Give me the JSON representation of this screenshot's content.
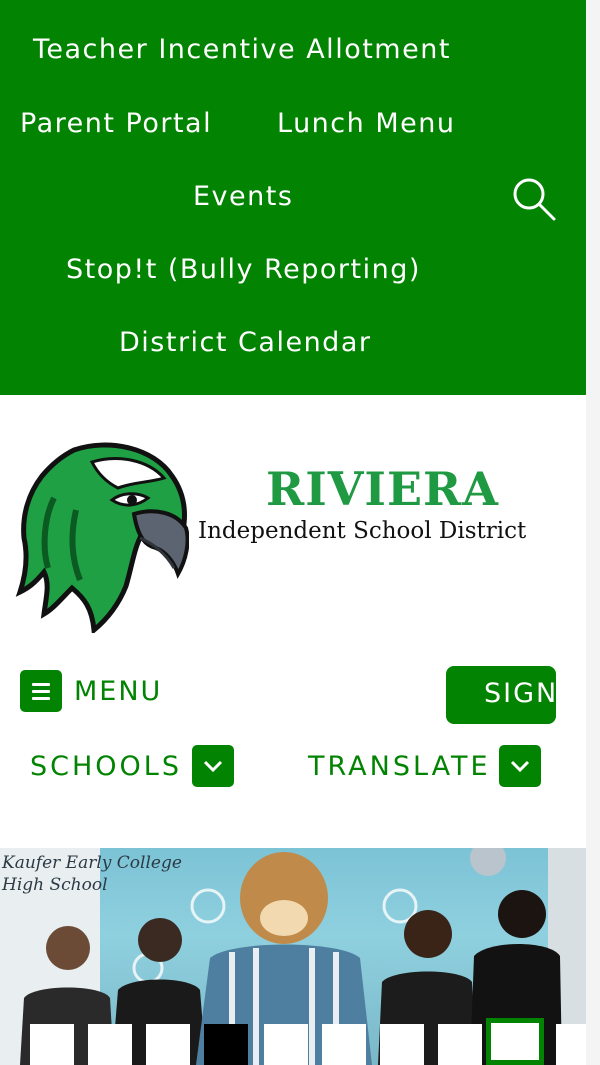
{
  "nav": {
    "links": [
      {
        "label": "Teacher Incentive Allotment"
      },
      {
        "label": "Parent Portal"
      },
      {
        "label": "Lunch Menu"
      },
      {
        "label": "Events"
      },
      {
        "label": "Stop!t (Bully Reporting)"
      },
      {
        "label": "District Calendar"
      }
    ],
    "search_icon": "search-icon"
  },
  "brand": {
    "name": "RIVIERA",
    "subtitle": "Independent School District",
    "logo_icon": "hawk-mascot-logo"
  },
  "controls": {
    "menu_label": "MENU",
    "sign_label": "SIGN",
    "schools_label": "SCHOOLS",
    "translate_label": "TRANSLATE"
  },
  "hero": {
    "script_text": "Kaufer Early College\nHigh School",
    "carousel_count": 10,
    "active_slide": 9
  },
  "colors": {
    "primary_green": "#028302",
    "brand_green": "#1f9a43",
    "white": "#ffffff"
  }
}
